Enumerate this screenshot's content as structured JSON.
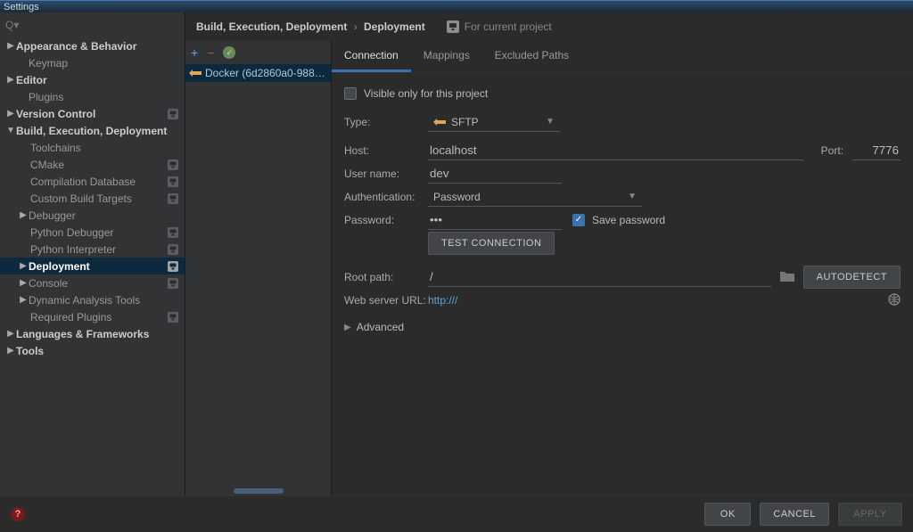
{
  "window": {
    "title": "Settings"
  },
  "search_label": "Q▾",
  "sidebar": {
    "appearance": "Appearance & Behavior",
    "keymap": "Keymap",
    "editor": "Editor",
    "plugins": "Plugins",
    "vcs": "Version Control",
    "bed": "Build, Execution, Deployment",
    "bed_children": {
      "toolchains": "Toolchains",
      "cmake": "CMake",
      "compdb": "Compilation Database",
      "cbt": "Custom Build Targets",
      "debugger": "Debugger",
      "pydbg": "Python Debugger",
      "pyintp": "Python Interpreter",
      "deployment": "Deployment",
      "console": "Console",
      "dat": "Dynamic Analysis Tools",
      "reqplg": "Required Plugins"
    },
    "langfw": "Languages & Frameworks",
    "tools": "Tools"
  },
  "breadcrumb": {
    "a": "Build, Execution, Deployment",
    "b": "Deployment"
  },
  "for_project": "For current project",
  "server_list": {
    "item0": "Docker (6d2860a0-9880-403..."
  },
  "tabs": {
    "connection": "Connection",
    "mappings": "Mappings",
    "excluded": "Excluded Paths"
  },
  "form": {
    "visible_only": "Visible only for this project",
    "type_label": "Type:",
    "type_value": "SFTP",
    "host_label": "Host:",
    "host_value": "localhost",
    "port_label": "Port:",
    "port_value": "7776",
    "user_label": "User name:",
    "user_value": "dev",
    "auth_label": "Authentication:",
    "auth_value": "Password",
    "password_label": "Password:",
    "password_value": "•••",
    "save_password": "Save password",
    "test_button": "TEST CONNECTION",
    "root_label": "Root path:",
    "root_value": "/",
    "autodetect": "AUTODETECT",
    "web_label": "Web server URL:",
    "web_value": "http:///",
    "advanced": "Advanced"
  },
  "footer": {
    "ok": "OK",
    "cancel": "CANCEL",
    "apply": "APPLY"
  }
}
